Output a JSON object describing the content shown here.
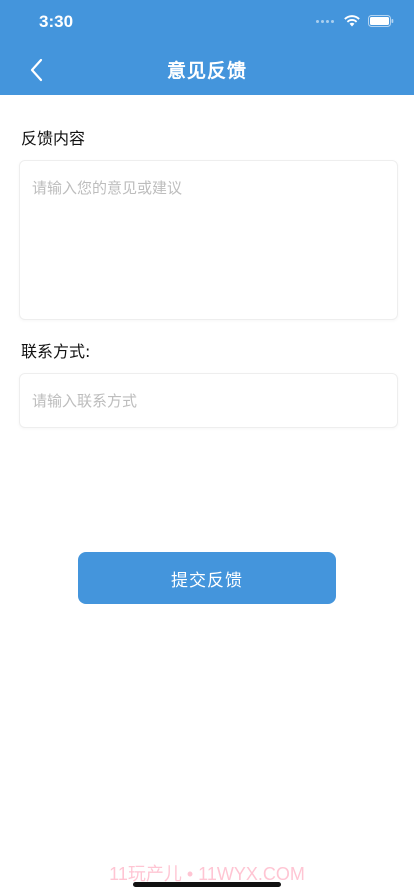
{
  "status_bar": {
    "time": "3:30"
  },
  "nav": {
    "title": "意见反馈",
    "back_icon": "chevron-left-icon"
  },
  "form": {
    "content_label": "反馈内容",
    "content_placeholder": "请输入您的意见或建议",
    "content_value": "",
    "contact_label": "联系方式:",
    "contact_placeholder": "请输入联系方式",
    "contact_value": ""
  },
  "submit": {
    "label": "提交反馈"
  },
  "watermark": {
    "text": "11玩产儿 • 11WYX.COM"
  },
  "colors": {
    "primary": "#4495dc",
    "placeholder": "#bdbdbd",
    "background": "#ffffff"
  }
}
